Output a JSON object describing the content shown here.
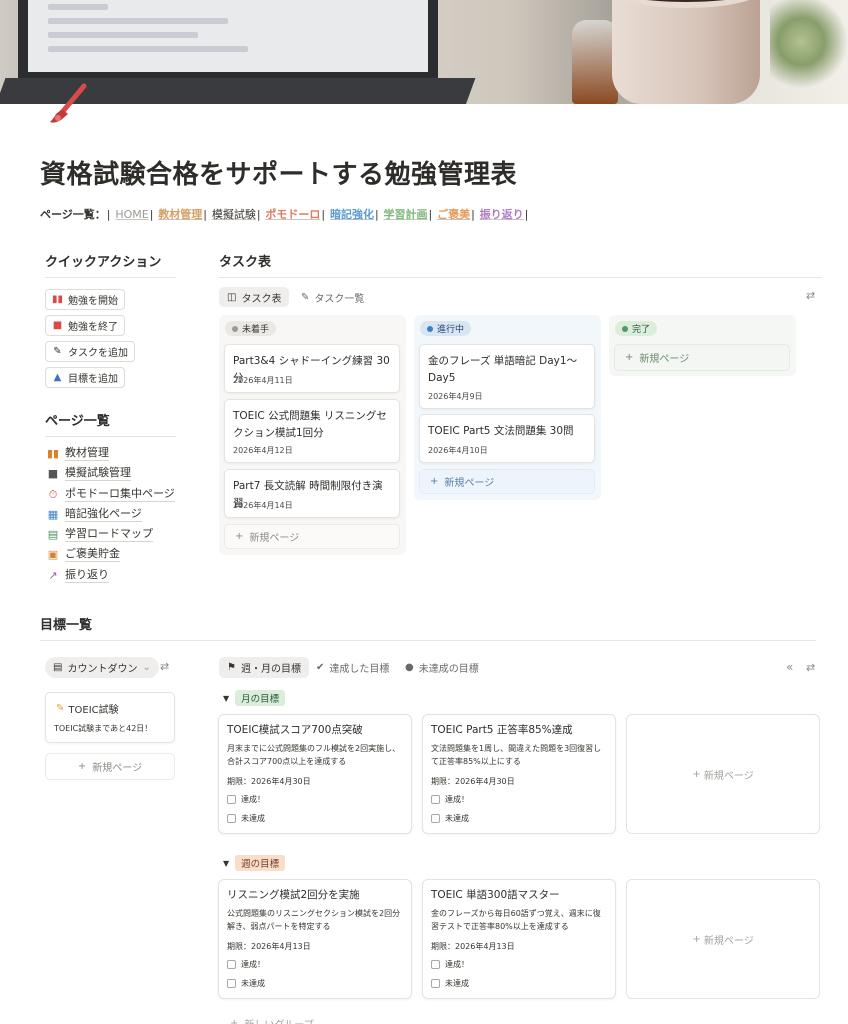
{
  "page": {
    "title": "資格試験合格をサポートする勉強管理表",
    "nav_prefix": "ページ一覧：",
    "nav_links": [
      {
        "label": "HOME",
        "color": "#9b9a97"
      },
      {
        "label": "教材管理",
        "color": "#d9a066"
      },
      {
        "label": "模擬試験",
        "color": "#37352f"
      },
      {
        "label": "ポモドーロ",
        "color": "#e07a5f"
      },
      {
        "label": "暗記強化",
        "color": "#5b9bd5"
      },
      {
        "label": "学習計画",
        "color": "#7fb77e"
      },
      {
        "label": "ご褒美",
        "color": "#e69b5a"
      },
      {
        "label": "振り返り",
        "color": "#b07cc6"
      }
    ]
  },
  "quick_actions": {
    "heading": "クイックアクション",
    "buttons": [
      {
        "label": "勉強を開始",
        "icon": "book-icon"
      },
      {
        "label": "勉強を終了",
        "icon": "closed-book-icon"
      },
      {
        "label": "タスクを追加",
        "icon": "edit-icon"
      },
      {
        "label": "目標を追加",
        "icon": "flag-climber-icon"
      }
    ]
  },
  "page_list": {
    "heading": "ページ一覧",
    "items": [
      {
        "label": "教材管理",
        "icon": "books-icon"
      },
      {
        "label": "模擬試験管理",
        "icon": "document-icon"
      },
      {
        "label": "ポモドーロ集中ページ",
        "icon": "stopwatch-icon"
      },
      {
        "label": "暗記強化ページ",
        "icon": "cards-icon"
      },
      {
        "label": "学習ロードマップ",
        "icon": "map-icon"
      },
      {
        "label": "ご褒美貯金",
        "icon": "gift-icon"
      },
      {
        "label": "振り返り",
        "icon": "chart-icon"
      }
    ]
  },
  "tasks": {
    "heading": "タスク表",
    "tabs": [
      "タスク表",
      "タスク一覧"
    ],
    "columns": [
      {
        "status": "未着手",
        "cards": [
          {
            "title": "Part3&4 シャドーイング練習 30分",
            "date": "2026年4月11日"
          },
          {
            "title": "TOEIC 公式問題集 リスニングセクション模試1回分",
            "date": "2026年4月12日"
          },
          {
            "title": "Part7 長文読解 時間制限付き演習",
            "date": "2026年4月14日"
          }
        ]
      },
      {
        "status": "進行中",
        "cards": [
          {
            "title": "金のフレーズ 単語暗記 Day1～Day5",
            "date": "2026年4月9日"
          },
          {
            "title": "TOEIC Part5 文法問題集 30問",
            "date": "2026年4月10日"
          }
        ]
      },
      {
        "status": "完了",
        "cards": []
      }
    ],
    "new_page": "新規ページ"
  },
  "goals": {
    "heading": "目標一覧",
    "countdown": {
      "tab": "カウントダウン",
      "card_title": "TOEIC試験",
      "card_text": "TOEIC試験まであと42日！",
      "new_page": "新規ページ"
    },
    "tabs": [
      "週・月の目標",
      "達成した目標",
      "未達成の目標"
    ],
    "groups": [
      {
        "tag": "月の目標",
        "cards": [
          {
            "title": "TOEIC模試スコア700点突破",
            "desc": "月末までに公式問題集のフル模試を2回実施し、合計スコア700点以上を達成する",
            "deadline": "期限：2026年4月30日",
            "done": "達成！",
            "undone": "未達成"
          },
          {
            "title": "TOEIC Part5 正答率85%達成",
            "desc": "文法問題集を1周し、間違えた問題を3回復習して正答率85%以上にする",
            "deadline": "期限：2026年4月30日",
            "done": "達成！",
            "undone": "未達成"
          }
        ]
      },
      {
        "tag": "週の目標",
        "cards": [
          {
            "title": "リスニング模試2回分を実施",
            "desc": "公式問題集のリスニングセクション模試を2回分解き、弱点パートを特定する",
            "deadline": "期限：2026年4月13日",
            "done": "達成！",
            "undone": "未達成"
          },
          {
            "title": "TOEIC 単語300語マスター",
            "desc": "金のフレーズから毎日60語ずつ覚え、週末に復習テストで正答率80%以上を達成する",
            "deadline": "期限：2026年4月13日",
            "done": "達成！",
            "undone": "未達成"
          }
        ]
      }
    ],
    "new_page": "新規ページ",
    "new_group": "新しいグループ"
  }
}
